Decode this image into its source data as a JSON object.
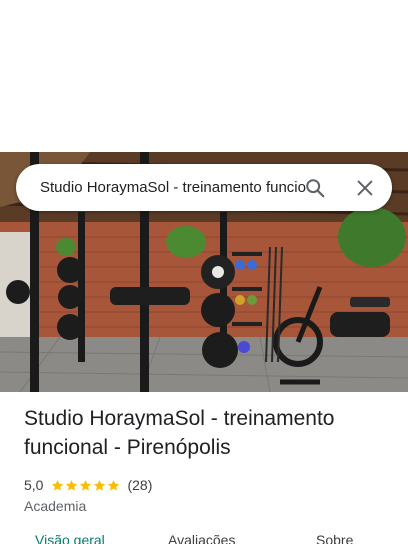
{
  "search": {
    "query": "Studio HoraymaSol - treinamento funcional - Pirenópolis",
    "search_icon": "search-icon",
    "close_icon": "close-icon"
  },
  "place": {
    "title": "Studio HoraymaSol - treinamento funcional - Pirenópolis",
    "rating": "5,0",
    "rating_value": 5.0,
    "stars_filled": 5,
    "review_count": "(28)",
    "category": "Academia"
  },
  "tabs": [
    {
      "label": "Visão geral",
      "active": true
    },
    {
      "label": "Avaliações",
      "active": false
    },
    {
      "label": "Sobre",
      "active": false
    }
  ],
  "colors": {
    "accent": "#0b7a6f",
    "star": "#fbbc04"
  }
}
